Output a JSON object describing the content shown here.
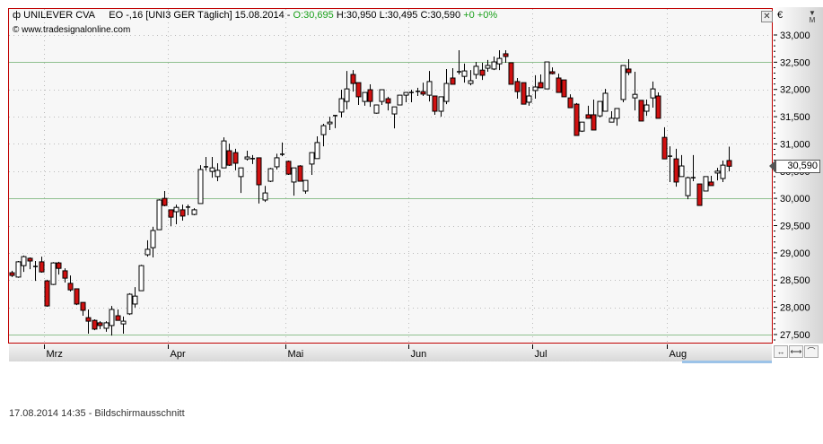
{
  "header": {
    "symbol": "UNILEVER CVA",
    "info": "EO -,16 [UNI3 GER  Täglich] 15.08.2014 -",
    "open": "O:30,695",
    "high": "H:30,950",
    "low": "L:30,495",
    "close": "C:30,590",
    "change": "+0 +0%",
    "source": "www.tradesignalonline.com"
  },
  "axis": {
    "currency": "€",
    "mode_button": "M",
    "last_price_tag": "30,590"
  },
  "footer": {
    "text": "17.08.2014 14:35 - Bildschirmausschnitt"
  },
  "colors": {
    "up": "#ffffff",
    "down": "#d01010",
    "frame": "#c00000",
    "guide": "#8fc08f"
  },
  "chart_data": {
    "type": "candlestick",
    "title": "UNILEVER CVA",
    "ylim": [
      27500,
      33000
    ],
    "y_ticks": [
      "27,500",
      "28,000",
      "28,500",
      "29,000",
      "29,500",
      "30,000",
      "30,500",
      "31,000",
      "31,500",
      "32,000",
      "32,500",
      "33,000"
    ],
    "y_tick_values": [
      27500,
      28000,
      28500,
      29000,
      29500,
      30000,
      30500,
      31000,
      31500,
      32000,
      32500,
      33000
    ],
    "guide_lines": [
      27500,
      30000,
      32500
    ],
    "x_ticks": [
      {
        "label": "Mrz",
        "index": 6
      },
      {
        "label": "Apr",
        "index": 27
      },
      {
        "label": "Mai",
        "index": 47
      },
      {
        "label": "Jun",
        "index": 68
      },
      {
        "label": "Jul",
        "index": 89
      },
      {
        "label": "Aug",
        "index": 112
      }
    ],
    "ohlc": [
      [
        28635,
        28670,
        28555,
        28585
      ],
      [
        28555,
        28850,
        28540,
        28835
      ],
      [
        28765,
        28950,
        28650,
        28930
      ],
      [
        28900,
        28915,
        28700,
        28850
      ],
      [
        28750,
        28850,
        28485,
        28750
      ],
      [
        28835,
        28930,
        28635,
        28650
      ],
      [
        28485,
        28505,
        28010,
        28025
      ],
      [
        28420,
        28830,
        28410,
        28815
      ],
      [
        28815,
        28835,
        28600,
        28715
      ],
      [
        28670,
        28715,
        28455,
        28535
      ],
      [
        28440,
        28585,
        28290,
        28320
      ],
      [
        28340,
        28340,
        28040,
        28060
      ],
      [
        28090,
        28090,
        27845,
        27945
      ],
      [
        27810,
        27960,
        27515,
        27745
      ],
      [
        27760,
        27780,
        27580,
        27600
      ],
      [
        27715,
        27745,
        27600,
        27665
      ],
      [
        27615,
        27745,
        27550,
        27715
      ],
      [
        27665,
        28025,
        27480,
        27960
      ],
      [
        27845,
        27960,
        27760,
        27760
      ],
      [
        27695,
        27830,
        27515,
        27745
      ],
      [
        27880,
        28260,
        27860,
        28240
      ],
      [
        28060,
        28370,
        27995,
        28205
      ],
      [
        28305,
        28780,
        28300,
        28765
      ],
      [
        28965,
        29230,
        28930,
        29065
      ],
      [
        29095,
        29475,
        28915,
        29410
      ],
      [
        29425,
        29985,
        29425,
        29970
      ],
      [
        30000,
        30135,
        29855,
        29870
      ],
      [
        29790,
        29790,
        29490,
        29655
      ],
      [
        29755,
        29885,
        29525,
        29835
      ],
      [
        29790,
        29885,
        29590,
        29675
      ],
      [
        29835,
        29885,
        29690,
        29840
      ],
      [
        29705,
        29820,
        29690,
        29790
      ],
      [
        29905,
        30610,
        29905,
        30530
      ],
      [
        30580,
        30760,
        30510,
        30575
      ],
      [
        30495,
        30760,
        30380,
        30560
      ],
      [
        30400,
        30645,
        30315,
        30515
      ],
      [
        30560,
        31120,
        30560,
        31055
      ],
      [
        30875,
        31005,
        30595,
        30610
      ],
      [
        30840,
        30910,
        30515,
        30645
      ],
      [
        30400,
        30560,
        30100,
        30560
      ],
      [
        30725,
        30875,
        30695,
        30760
      ],
      [
        30730,
        30795,
        30630,
        30725
      ],
      [
        30745,
        30745,
        29905,
        30250
      ],
      [
        29970,
        30230,
        29935,
        30100
      ],
      [
        30315,
        30560,
        30300,
        30545
      ],
      [
        30580,
        30820,
        30530,
        30745
      ],
      [
        30810,
        31025,
        30775,
        30810
      ],
      [
        30680,
        30695,
        30430,
        30445
      ],
      [
        30300,
        30560,
        30050,
        30560
      ],
      [
        30595,
        30610,
        30315,
        30315
      ],
      [
        30135,
        30330,
        30085,
        30330
      ],
      [
        30630,
        30840,
        30430,
        30840
      ],
      [
        30730,
        31140,
        30730,
        31025
      ],
      [
        31170,
        31370,
        30955,
        31335
      ],
      [
        31370,
        31500,
        31255,
        31400
      ],
      [
        31520,
        31520,
        31290,
        31515
      ],
      [
        31585,
        31995,
        31485,
        31830
      ],
      [
        31780,
        32340,
        31635,
        32010
      ],
      [
        32275,
        32355,
        31960,
        32110
      ],
      [
        32125,
        32125,
        31715,
        31865
      ],
      [
        31780,
        31945,
        31700,
        31945
      ],
      [
        31995,
        32095,
        31680,
        31780
      ],
      [
        31565,
        31720,
        31555,
        31715
      ],
      [
        31780,
        31995,
        31715,
        31995
      ],
      [
        31830,
        31865,
        31615,
        31750
      ],
      [
        31550,
        31680,
        31285,
        31680
      ],
      [
        31715,
        31900,
        31710,
        31895
      ],
      [
        31895,
        31945,
        31765,
        31945
      ],
      [
        31945,
        31995,
        31765,
        31945
      ],
      [
        31960,
        32030,
        31880,
        31965
      ],
      [
        31960,
        32125,
        31880,
        31915
      ],
      [
        31895,
        32340,
        31780,
        32145
      ],
      [
        31880,
        31880,
        31535,
        31600
      ],
      [
        31600,
        31865,
        31500,
        31865
      ],
      [
        31780,
        32375,
        31730,
        32110
      ],
      [
        32210,
        32390,
        32095,
        32095
      ],
      [
        32325,
        32720,
        32275,
        32325
      ],
      [
        32240,
        32475,
        32125,
        32340
      ],
      [
        32110,
        32355,
        32075,
        32160
      ],
      [
        32275,
        32505,
        32195,
        32425
      ],
      [
        32355,
        32490,
        32175,
        32260
      ],
      [
        32390,
        32540,
        32325,
        32440
      ],
      [
        32375,
        32605,
        32355,
        32505
      ],
      [
        32470,
        32720,
        32355,
        32570
      ],
      [
        32655,
        32720,
        32490,
        32605
      ],
      [
        32490,
        32490,
        32095,
        32095
      ],
      [
        32145,
        32210,
        31830,
        31960
      ],
      [
        32125,
        32125,
        31730,
        31730
      ],
      [
        31765,
        32045,
        31700,
        31880
      ],
      [
        31980,
        32260,
        31830,
        32045
      ],
      [
        32125,
        32275,
        32030,
        32030
      ],
      [
        32010,
        32505,
        32010,
        32505
      ],
      [
        32325,
        32405,
        32275,
        32290
      ],
      [
        32210,
        32290,
        31945,
        31945
      ],
      [
        32175,
        32175,
        31865,
        31865
      ],
      [
        31845,
        31910,
        31665,
        31665
      ],
      [
        31730,
        31750,
        31155,
        31155
      ],
      [
        31235,
        31400,
        31220,
        31400
      ],
      [
        31535,
        31700,
        31470,
        31470
      ],
      [
        31535,
        31815,
        31255,
        31255
      ],
      [
        31515,
        31780,
        31485,
        31780
      ],
      [
        31600,
        32010,
        31600,
        31930
      ],
      [
        31400,
        31600,
        31400,
        31470
      ],
      [
        31470,
        31650,
        31335,
        31650
      ],
      [
        31815,
        32440,
        31765,
        32440
      ],
      [
        32375,
        32555,
        32260,
        32310
      ],
      [
        31845,
        32325,
        31615,
        31910
      ],
      [
        31800,
        31800,
        31420,
        31420
      ],
      [
        31600,
        31815,
        31515,
        31715
      ],
      [
        31845,
        32145,
        31665,
        32010
      ],
      [
        31880,
        31945,
        31470,
        31470
      ],
      [
        31120,
        31305,
        30725,
        30725
      ],
      [
        30775,
        30955,
        30300,
        30775
      ],
      [
        30725,
        30910,
        30215,
        30300
      ],
      [
        30400,
        30795,
        30400,
        30595
      ],
      [
        30050,
        30400,
        29985,
        30380
      ],
      [
        30380,
        30795,
        30315,
        30380
      ],
      [
        30265,
        30265,
        29870,
        29870
      ],
      [
        30135,
        30400,
        30135,
        30400
      ],
      [
        30300,
        30415,
        30235,
        30235
      ],
      [
        30465,
        30560,
        30330,
        30500
      ],
      [
        30365,
        30695,
        30300,
        30610
      ],
      [
        30695,
        30950,
        30495,
        30590
      ]
    ]
  }
}
